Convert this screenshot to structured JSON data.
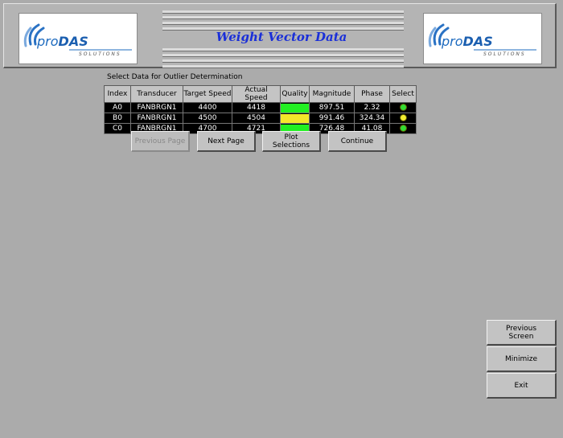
{
  "header": {
    "title": "Weight Vector Data",
    "logo_text_main": "pro",
    "logo_text_accent": "DAS",
    "logo_sub": "SOLUTIONS"
  },
  "section_label": "Select Data for Outlier Determination",
  "table": {
    "columns": [
      "Index",
      "Transducer",
      "Target Speed",
      "Actual Speed",
      "Quality",
      "Magnitude",
      "Phase",
      "Select"
    ],
    "rows": [
      {
        "index": "A0",
        "transducer": "FANBRGN1",
        "target_speed": "4400",
        "actual_speed": "4418",
        "quality_color": "#22f022",
        "magnitude": "897.51",
        "phase": "2.32",
        "select_color": "#33dd33"
      },
      {
        "index": "B0",
        "transducer": "FANBRGN1",
        "target_speed": "4500",
        "actual_speed": "4504",
        "quality_color": "#f5e62a",
        "magnitude": "991.46",
        "phase": "324.34",
        "select_color": "#f2ee30"
      },
      {
        "index": "C0",
        "transducer": "FANBRGN1",
        "target_speed": "4700",
        "actual_speed": "4721",
        "quality_color": "#22f022",
        "magnitude": "726.48",
        "phase": "41.08",
        "select_color": "#33dd33"
      }
    ]
  },
  "buttons": {
    "previous_page": "Previous Page",
    "next_page": "Next Page",
    "plot_selections_line1": "Plot",
    "plot_selections_line2": "Selections",
    "continue": "Continue",
    "previous_screen_line1": "Previous",
    "previous_screen_line2": "Screen",
    "minimize": "Minimize",
    "exit": "Exit"
  }
}
